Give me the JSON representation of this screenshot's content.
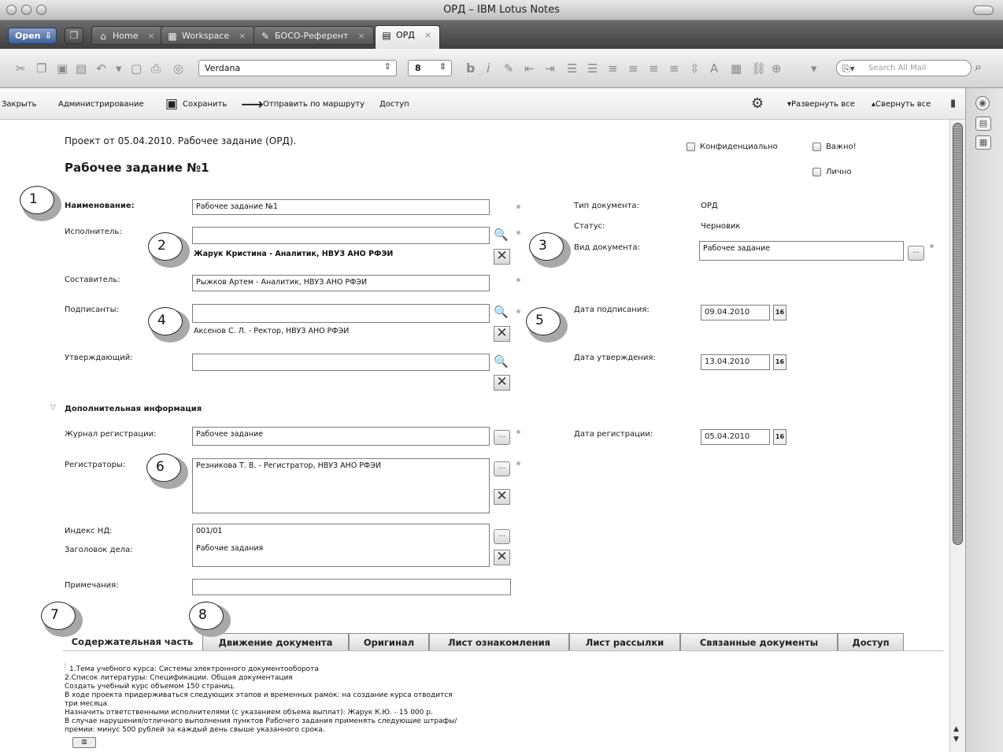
{
  "window": {
    "title": "ОРД – IBM Lotus Notes"
  },
  "tabs": {
    "open_label": "Open",
    "items": [
      {
        "label": "Home"
      },
      {
        "label": "Workspace"
      },
      {
        "label": "БОСО-Референт"
      },
      {
        "label": "ОРД"
      }
    ]
  },
  "toolbar": {
    "font": "Verdana",
    "size": "8",
    "search_placeholder": "Search All Mail"
  },
  "actions": {
    "close": "Закрыть",
    "admin": "Администрирование",
    "save": "Сохранить",
    "route": "Отправить по маршруту",
    "access": "Доступ",
    "expand_all": "Развернуть все",
    "collapse_all": "Свернуть все"
  },
  "doc": {
    "subtitle": "Проект от 05.04.2010. Рабочее задание (ОРД).",
    "title": "Рабочее задание №1",
    "flags": {
      "confidential": "Конфиденциально",
      "important": "Важно!",
      "personal": "Лично"
    }
  },
  "fields": {
    "name": {
      "label": "Наименование:",
      "value": "Рабочее задание №1"
    },
    "executor": {
      "label": "Исполнитель:",
      "value": "",
      "selected": "Жарук Кристина - Аналитик, НВУЗ АНО РФЭИ"
    },
    "author": {
      "label": "Составитель:",
      "value": "Рыжков Артем - Аналитик, НВУЗ АНО РФЭИ"
    },
    "signers": {
      "label": "Подписанты:",
      "value": "",
      "selected": "Аксенов С. Л. - Ректор, НВУЗ АНО РФЭИ"
    },
    "approver": {
      "label": "Утверждающий:",
      "value": ""
    },
    "doc_type": {
      "label": "Тип документа:",
      "value": "ОРД"
    },
    "status": {
      "label": "Статус:",
      "value": "Черновик"
    },
    "doc_kind": {
      "label": "Вид документа:",
      "value": "Рабочее задание"
    },
    "sign_date": {
      "label": "Дата подписания:",
      "value": "09.04.2010"
    },
    "approve_date": {
      "label": "Дата утверждения:",
      "value": "13.04.2010"
    },
    "calendar_icon": "16"
  },
  "extra": {
    "section_title": "Дополнительная информация",
    "journal": {
      "label": "Журнал регистрации:",
      "value": "Рабочее задание"
    },
    "registrars": {
      "label": "Регистраторы:",
      "value": "Резникова Т. В. - Регистратор, НВУЗ АНО РФЭИ"
    },
    "reg_date": {
      "label": "Дата регистрации:",
      "value": "05.04.2010"
    },
    "nd_index": {
      "label": "Индекс НД:",
      "value": "001/01"
    },
    "case_title": {
      "label": "Заголовок дела:",
      "value": "Рабочие задания"
    },
    "notes": {
      "label": "Примечания:",
      "value": ""
    }
  },
  "callouts": [
    "1",
    "2",
    "3",
    "4",
    "5",
    "6",
    "7",
    "8"
  ],
  "bottom_tabs": [
    "Содержательная часть",
    "Движение документа",
    "Оригинал",
    "Лист ознакомления",
    "Лист рассылки",
    "Связанные документы",
    "Доступ"
  ],
  "content": {
    "lines": [
      "1.Тема учебного курса: Системы электронного документооборота",
      "2.Список литературы: Спецификации. Общая документация",
      "Создать учебный курс объемом 150 страниц.",
      "В ходе проекта придерживаться следующих этапов и временных рамок: на создание курса отводится",
      "три месяца",
      "Назначить ответственными исполнителями (с указанием объема выплат): Жарук К.Ю. - 15 000 р.",
      "В случае нарушения/отличного выполнения пунктов Рабочего задания применять следующие штрафы/",
      "премии: минус 500 рублей за каждый день свыше указанного срока."
    ]
  }
}
